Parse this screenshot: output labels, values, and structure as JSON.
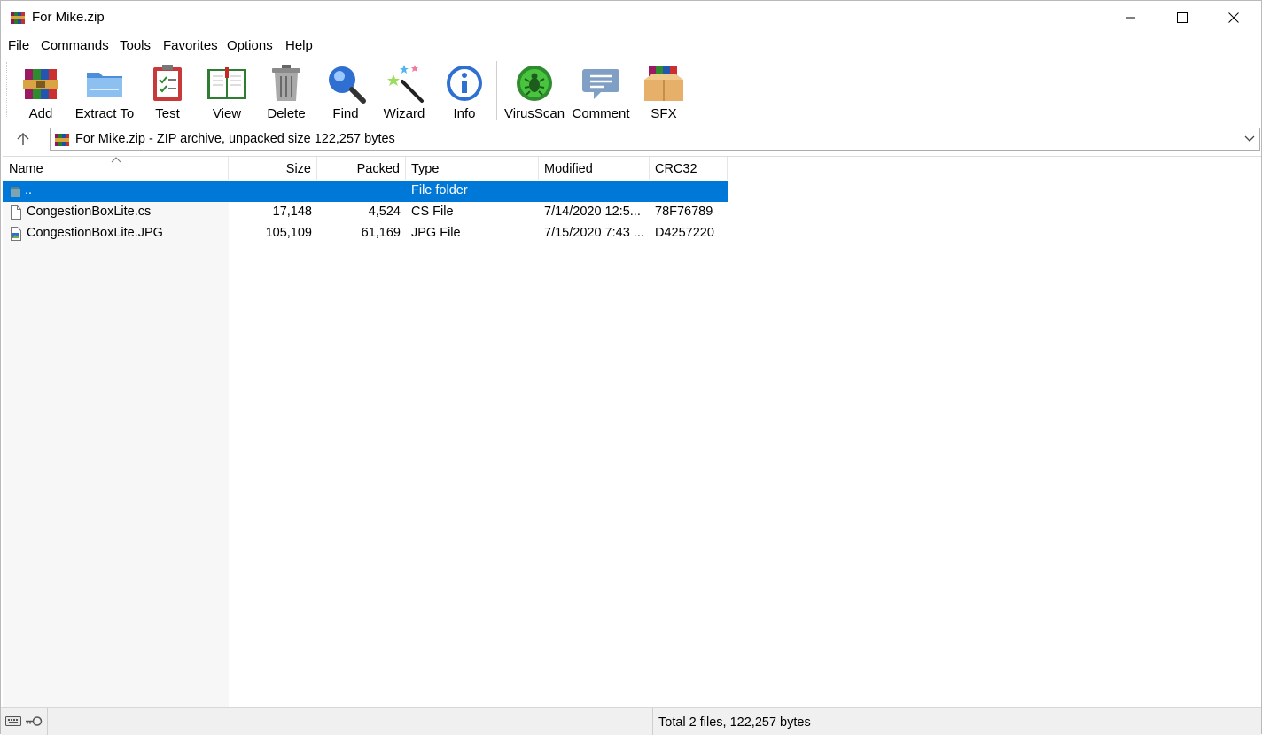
{
  "window": {
    "title": "For Mike.zip"
  },
  "menu": [
    "File",
    "Commands",
    "Tools",
    "Favorites",
    "Options",
    "Help"
  ],
  "toolbar": {
    "buttons": [
      {
        "label": "Add",
        "icon": "add-archive-icon"
      },
      {
        "label": "Extract To",
        "icon": "extract-folder-icon"
      },
      {
        "label": "Test",
        "icon": "test-clipboard-icon"
      },
      {
        "label": "View",
        "icon": "view-book-icon"
      },
      {
        "label": "Delete",
        "icon": "trash-icon"
      },
      {
        "label": "Find",
        "icon": "magnifier-icon"
      },
      {
        "label": "Wizard",
        "icon": "magic-wand-icon"
      },
      {
        "label": "Info",
        "icon": "info-icon"
      },
      {
        "label": "VirusScan",
        "icon": "virus-scan-icon"
      },
      {
        "label": "Comment",
        "icon": "comment-icon"
      },
      {
        "label": "SFX",
        "icon": "sfx-box-icon"
      }
    ]
  },
  "address": {
    "text": "For Mike.zip - ZIP archive, unpacked size 122,257 bytes"
  },
  "list": {
    "columns": [
      "Name",
      "Size",
      "Packed",
      "Type",
      "Modified",
      "CRC32"
    ],
    "rows": [
      {
        "name": "..",
        "size": "",
        "packed": "",
        "type": "File folder",
        "modified": "",
        "crc": "",
        "selected": true
      },
      {
        "name": "CongestionBoxLite.cs",
        "size": "17,148",
        "packed": "4,524",
        "type": "CS File",
        "modified": "7/14/2020 12:5...",
        "crc": "78F76789",
        "selected": false
      },
      {
        "name": "CongestionBoxLite.JPG",
        "size": "105,109",
        "packed": "61,169",
        "type": "JPG File",
        "modified": "7/15/2020 7:43 ...",
        "crc": "D4257220",
        "selected": false
      }
    ]
  },
  "status": {
    "total": "Total 2 files, 122,257 bytes"
  },
  "colors": {
    "selection": "#0078d7",
    "name_column_bg": "#f7f7f7"
  }
}
